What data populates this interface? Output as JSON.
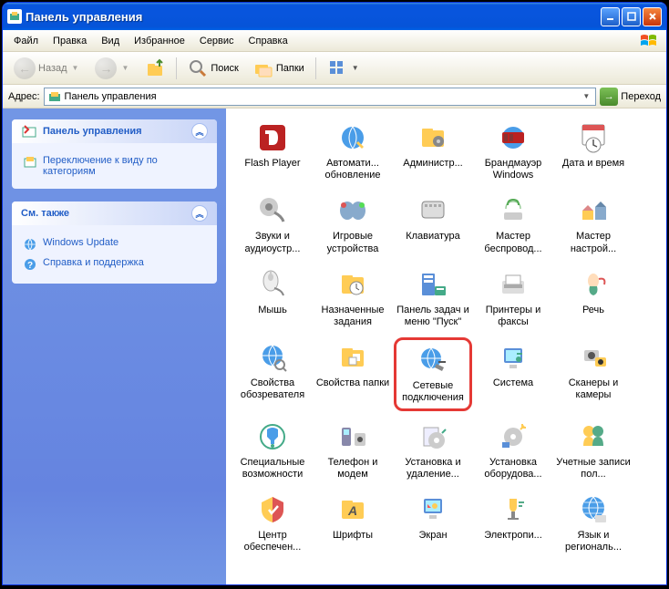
{
  "title": "Панель управления",
  "menu": {
    "file": "Файл",
    "edit": "Правка",
    "view": "Вид",
    "favorites": "Избранное",
    "tools": "Сервис",
    "help": "Справка"
  },
  "toolbar": {
    "back": "Назад",
    "search": "Поиск",
    "folders": "Папки"
  },
  "addressbar": {
    "label": "Адрес:",
    "value": "Панель управления",
    "go": "Переход"
  },
  "sidebar": {
    "panel1": {
      "title": "Панель управления",
      "link1": "Переключение к виду по категориям"
    },
    "panel2": {
      "title": "См. также",
      "link1": "Windows Update",
      "link2": "Справка и поддержка"
    }
  },
  "icons": [
    {
      "label": "Flash Player"
    },
    {
      "label": "Автомати... обновление"
    },
    {
      "label": "Администр..."
    },
    {
      "label": "Брандмауэр Windows"
    },
    {
      "label": "Дата и время"
    },
    {
      "label": "Звуки и аудиоустр..."
    },
    {
      "label": "Игровые устройства"
    },
    {
      "label": "Клавиатура"
    },
    {
      "label": "Мастер беспровод..."
    },
    {
      "label": "Мастер настрой..."
    },
    {
      "label": "Мышь"
    },
    {
      "label": "Назначенные задания"
    },
    {
      "label": "Панель задач и меню \"Пуск\""
    },
    {
      "label": "Принтеры и факсы"
    },
    {
      "label": "Речь"
    },
    {
      "label": "Свойства обозревателя"
    },
    {
      "label": "Свойства папки"
    },
    {
      "label": "Сетевые подключения"
    },
    {
      "label": "Система"
    },
    {
      "label": "Сканеры и камеры"
    },
    {
      "label": "Специальные возможности"
    },
    {
      "label": "Телефон и модем"
    },
    {
      "label": "Установка и удаление..."
    },
    {
      "label": "Установка оборудова..."
    },
    {
      "label": "Учетные записи пол..."
    },
    {
      "label": "Центр обеспечен..."
    },
    {
      "label": "Шрифты"
    },
    {
      "label": "Экран"
    },
    {
      "label": "Электропи..."
    },
    {
      "label": "Язык и региональ..."
    }
  ]
}
